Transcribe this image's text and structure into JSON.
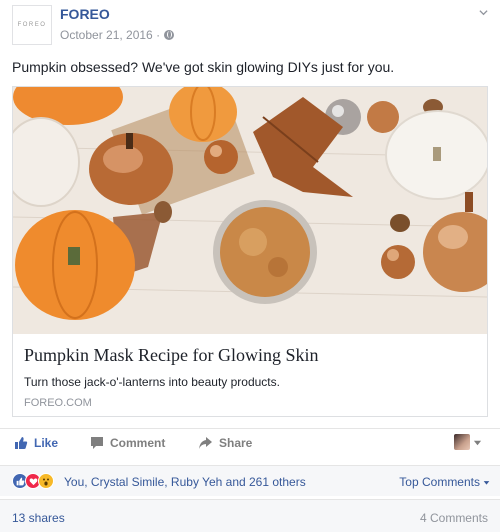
{
  "post": {
    "avatar_text": "FOREO",
    "page_name": "FOREO",
    "date": "October 21, 2016 ·",
    "text": "Pumpkin obsessed? We've got skin glowing DIYs just for you."
  },
  "link": {
    "title": "Pumpkin Mask Recipe for Glowing Skin",
    "description": "Turn those jack-o'-lanterns into beauty products.",
    "domain": "FOREO.COM"
  },
  "actions": {
    "like": "Like",
    "comment": "Comment",
    "share": "Share"
  },
  "reactions": {
    "text": "You, Crystal Simile, Ruby Yeh and 261 others",
    "top_comments": "Top Comments"
  },
  "footer": {
    "shares": "13 shares",
    "comments": "4 Comments"
  },
  "colors": {
    "link_blue": "#365899",
    "like_blue": "#4267b2",
    "meta_gray": "#90949c"
  }
}
